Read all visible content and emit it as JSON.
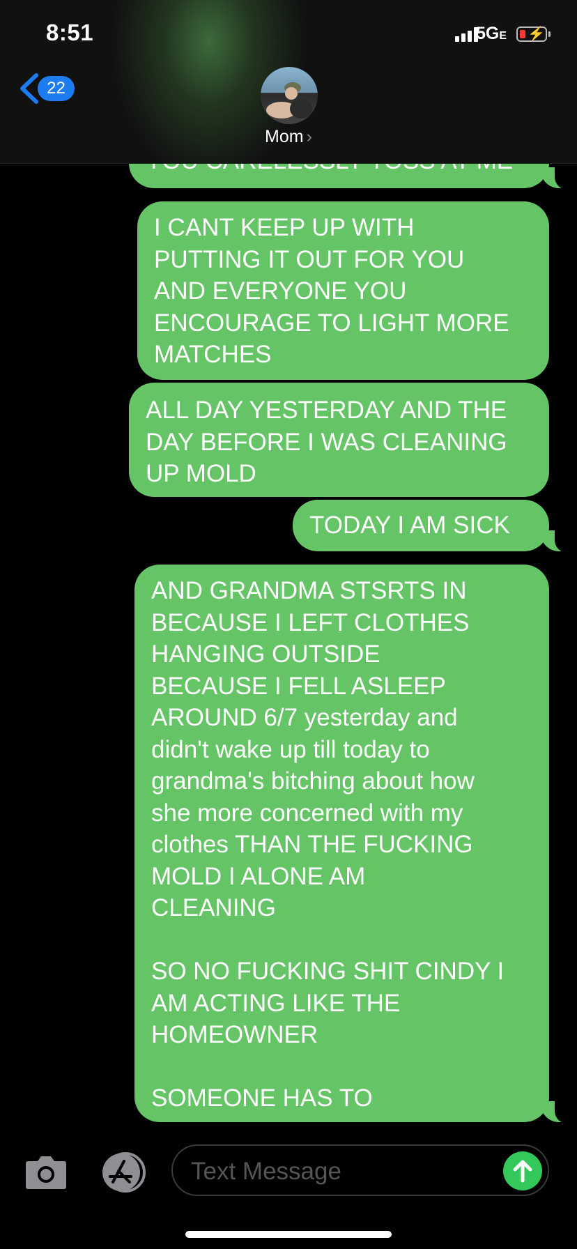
{
  "status_bar": {
    "time": "8:51",
    "network_main": "5G",
    "network_suffix": "E",
    "battery_color": "#ff3b30"
  },
  "header": {
    "back_count": "22",
    "contact_name": "Mom",
    "contact_chevron": "›",
    "avatar_icon": "contact-photo"
  },
  "messages": [
    {
      "text": "YOU CARELESSLY TOSS AT ME"
    },
    {
      "text": "I CANT KEEP UP WITH\nPUTTING IT OUT FOR YOU\nAND EVERYONE YOU\nENCOURAGE TO LIGHT MORE\nMATCHES"
    },
    {
      "text": "ALL DAY YESTERDAY AND THE\nDAY BEFORE I WAS CLEANING\nUP MOLD"
    },
    {
      "text": "TODAY I AM SICK"
    },
    {
      "text": "AND GRANDMA STSRTS IN\nBECAUSE I LEFT CLOTHES\nHANGING OUTSIDE\nBECAUSE I FELL ASLEEP\nAROUND 6/7 yesterday and\ndidn't wake up till today to\ngrandma's bitching about how\nshe more concerned with my\nclothes THAN THE FUCKING\nMOLD I ALONE AM\nCLEANING\n\nSO NO FUCKING SHIT CINDY I\nAM ACTING LIKE THE\nHOMEOWNER\n\nSOMEONE HAS TO"
    }
  ],
  "composer": {
    "placeholder": "Text Message",
    "camera_icon": "camera-icon",
    "appstore_icon": "app-store-icon",
    "send_icon": "arrow-up-icon"
  },
  "colors": {
    "bubble": "#65c466",
    "accent": "#1c7cf0",
    "send": "#34c759"
  }
}
